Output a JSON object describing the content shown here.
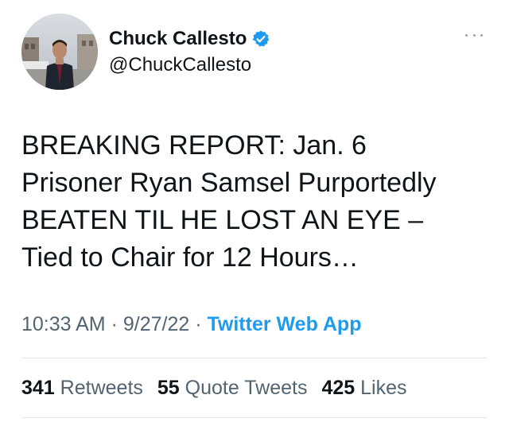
{
  "user": {
    "display_name": "Chuck Callesto",
    "handle": "@ChuckCallesto"
  },
  "icons": {
    "verified": "verified-badge-icon",
    "more": "more-horizontal-icon"
  },
  "colors": {
    "verified_blue": "#1d9bf0",
    "link_blue": "#1d9bf0",
    "secondary_text": "#536471"
  },
  "tweet": {
    "lines": [
      "BREAKING REPORT: Jan. 6",
      "Prisoner Ryan Samsel Purportedly",
      "BEATEN TIL HE LOST AN EYE –",
      "Tied to Chair for 12 Hours…"
    ]
  },
  "meta": {
    "time": "10:33 AM",
    "separator": " · ",
    "date": "9/27/22",
    "source": "Twitter Web App"
  },
  "stats": {
    "retweets_count": "341",
    "retweets_label": "Retweets",
    "quotes_count": "55",
    "quotes_label": "Quote Tweets",
    "likes_count": "425",
    "likes_label": "Likes"
  }
}
